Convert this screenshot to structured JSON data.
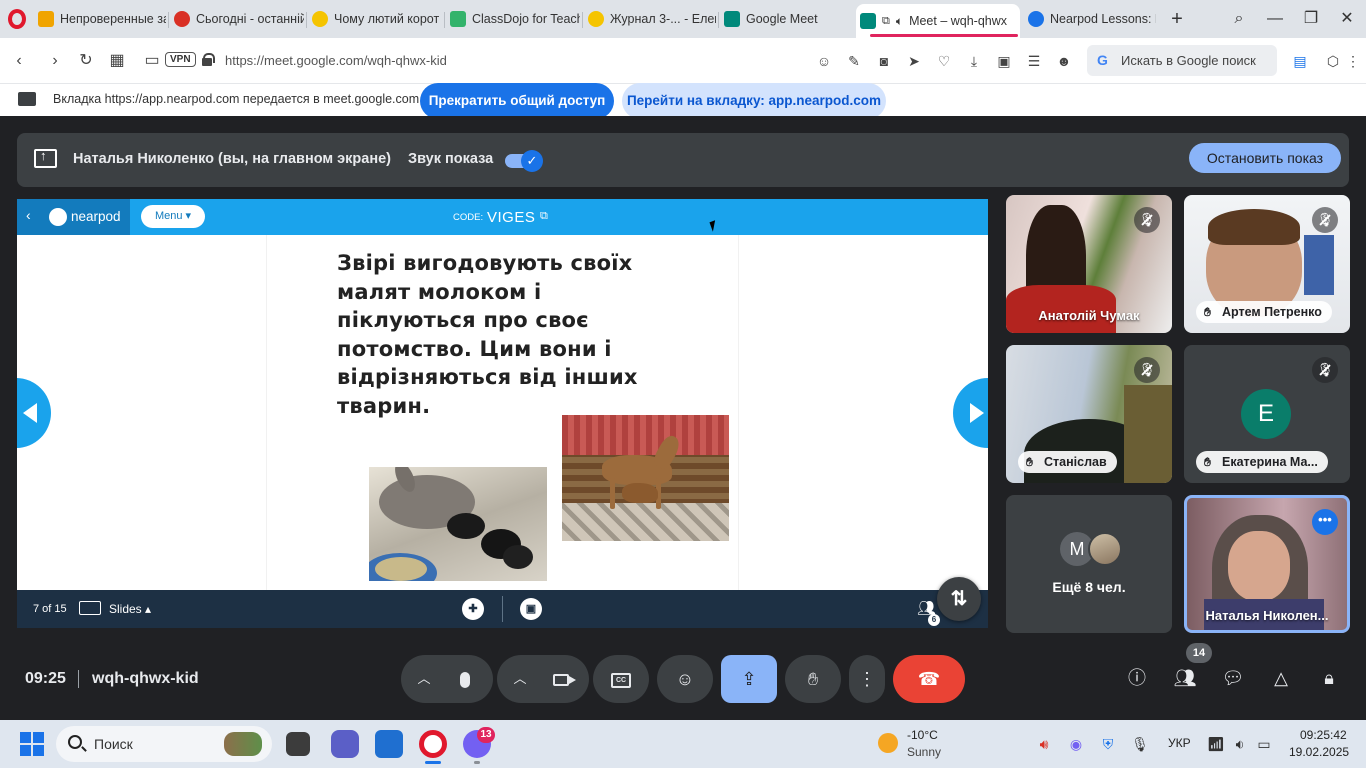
{
  "browser": {
    "tabs": [
      {
        "label": "Непроверенные за",
        "color": "#f0a400"
      },
      {
        "label": "Сьогодні - останній",
        "color": "#d93025"
      },
      {
        "label": "Чому лютий корот",
        "color": "#f5c400"
      },
      {
        "label": "ClassDojo for Teache",
        "color": "#33b36b"
      },
      {
        "label": "Журнал 3-... - Елект",
        "color": "#f5c400"
      },
      {
        "label": "Google Meet",
        "color": "#00897b"
      },
      {
        "label": "Meet – wqh-qhwx",
        "color": "#00897b"
      },
      {
        "label": "Nearpod Lessons: D",
        "color": "#1a73e8"
      }
    ],
    "url": "https://meet.google.com/wqh-qhwx-kid",
    "vpn_label": "VPN",
    "search_placeholder": "Искать в Google поиск"
  },
  "share_banner": {
    "text": "Вкладка https://app.nearpod.com передается в meet.google.com",
    "stop_label": "Прекратить общий доступ",
    "switch_label": "Перейти на вкладку: app.nearpod.com"
  },
  "present_bar": {
    "presenter": "Наталья Николенко (вы, на главном экране)",
    "sound_label": "Звук показа",
    "sound_on": true,
    "stop_label": "Остановить показ"
  },
  "nearpod": {
    "logo": "nearpod",
    "menu_label": "Menu",
    "code_label": "CODE:",
    "code": "VIGES",
    "slide_text": "Звірі вигодовують своїх малят молоком і піклуються про своє потомство. Цим вони і відрізняються від інших тварин.",
    "page": "7 of 15",
    "slides_label": "Slides",
    "students_count": "6"
  },
  "participants": [
    {
      "name": "Анатолій Чумак",
      "muted": true
    },
    {
      "name": "Артем Петренко",
      "muted": true
    },
    {
      "name": "Станіслав",
      "muted": true
    },
    {
      "name": "Екатерина Ма...",
      "muted": true,
      "initial": "E"
    },
    {
      "more_initial": "M",
      "more_label": "Ещё 8 чел."
    },
    {
      "name": "Наталья Николен..."
    }
  ],
  "controls": {
    "time": "09:25",
    "meeting_code": "wqh-qhwx-kid",
    "people_count": "14"
  },
  "taskbar": {
    "search_label": "Поиск",
    "viber_badge": "13",
    "weather_temp": "-10°C",
    "weather_cond": "Sunny",
    "lang": "УКР",
    "clock_time": "09:25:42",
    "clock_date": "19.02.2025"
  }
}
